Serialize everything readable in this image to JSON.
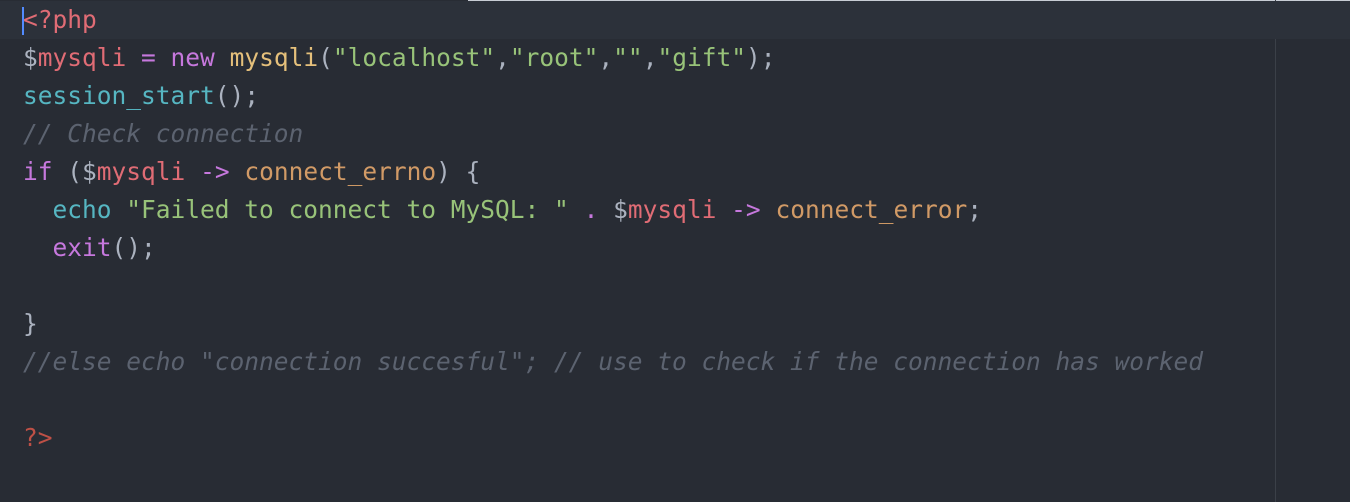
{
  "editor": {
    "language": "php",
    "theme_colors": {
      "background": "#282c34",
      "tag": "#e06c75",
      "variable": "#e06c75",
      "keyword": "#c678dd",
      "class": "#e5c07b",
      "string": "#98c379",
      "function": "#56b6c2",
      "comment": "#5c6370",
      "property": "#d19a66",
      "cursor": "#528bff"
    },
    "lines": [
      {
        "open_tag": "<?php"
      },
      {
        "dollar": "$",
        "var": "mysqli",
        "eq": " = ",
        "kw_new": "new",
        "sp": " ",
        "cls": "mysqli",
        "p_open": "(",
        "s1": "\"localhost\"",
        "c1": ",",
        "s2": "\"root\"",
        "c2": ",",
        "s3": "\"\"",
        "c3": ",",
        "s4": "\"gift\"",
        "p_close": ");"
      },
      {
        "fn": "session_start",
        "rest": "();"
      },
      {
        "comment": "// Check connection"
      },
      {
        "kw_if": "if",
        "p_open": " (",
        "dollar": "$",
        "var": "mysqli",
        "sp1": " ",
        "arrow": "->",
        "sp2": " ",
        "prop": "connect_errno",
        "rest": ") {"
      },
      {
        "indent": "  ",
        "kw_echo": "echo",
        "sp1": " ",
        "str": "\"Failed to connect to MySQL: \"",
        "sp2": " ",
        "dot": ".",
        "sp3": " ",
        "dollar": "$",
        "var": "mysqli",
        "sp4": " ",
        "arrow": "->",
        "sp5": " ",
        "prop": "connect_error",
        "rest": ";"
      },
      {
        "indent": "  ",
        "fn": "exit",
        "rest": "();"
      },
      {
        "text": ""
      },
      {
        "text": "}"
      },
      {
        "comment": "//else echo \"connection succesful\"; // use to check if the connection has worked"
      },
      {
        "text": ""
      },
      {
        "close_tag": "?>"
      }
    ]
  }
}
